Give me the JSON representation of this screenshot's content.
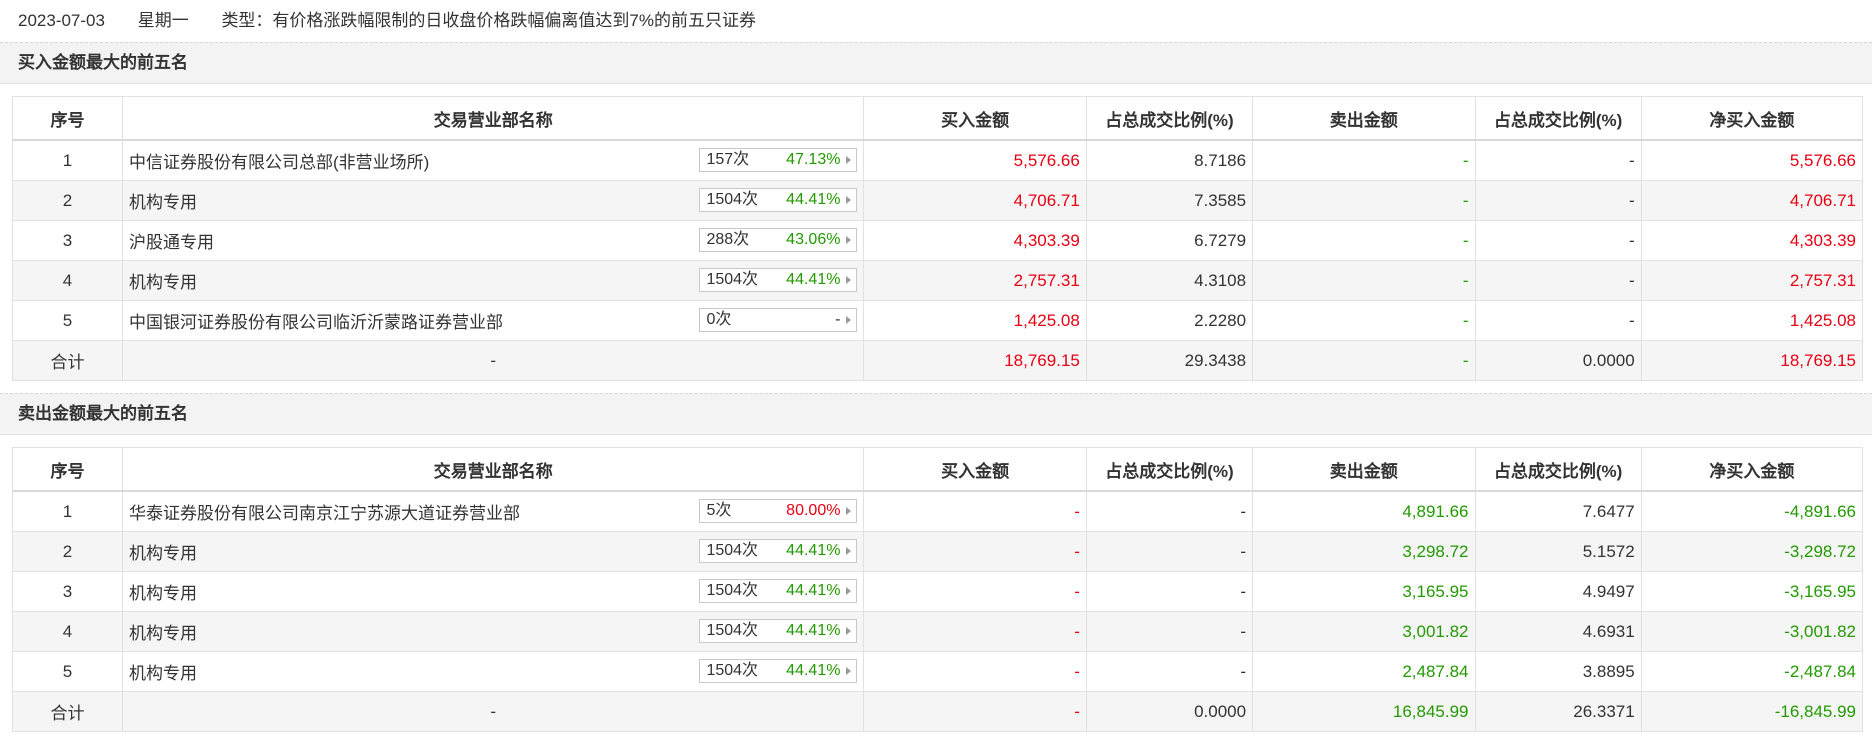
{
  "header": {
    "date": "2023-07-03",
    "weekday": "星期一",
    "type_text": "类型：有价格涨跌幅限制的日收盘价格跌幅偏离值达到7%的前五只证券"
  },
  "columns": [
    "序号",
    "交易营业部名称",
    "买入金额",
    "占总成交比例(%)",
    "卖出金额",
    "占总成交比例(%)",
    "净买入金额"
  ],
  "buy_section": {
    "title": "买入金额最大的前五名",
    "rows": [
      {
        "idx": "1",
        "name": "中信证券股份有限公司总部(非营业场所)",
        "count": "157次",
        "pct": "47.13%",
        "pct_color": "green",
        "buy": "5,576.66",
        "buy_ratio": "8.7186",
        "sell": "-",
        "sell_ratio": "-",
        "net": "5,576.66"
      },
      {
        "idx": "2",
        "name": "机构专用",
        "count": "1504次",
        "pct": "44.41%",
        "pct_color": "green",
        "buy": "4,706.71",
        "buy_ratio": "7.3585",
        "sell": "-",
        "sell_ratio": "-",
        "net": "4,706.71"
      },
      {
        "idx": "3",
        "name": "沪股通专用",
        "count": "288次",
        "pct": "43.06%",
        "pct_color": "green",
        "buy": "4,303.39",
        "buy_ratio": "6.7279",
        "sell": "-",
        "sell_ratio": "-",
        "net": "4,303.39"
      },
      {
        "idx": "4",
        "name": "机构专用",
        "count": "1504次",
        "pct": "44.41%",
        "pct_color": "green",
        "buy": "2,757.31",
        "buy_ratio": "4.3108",
        "sell": "-",
        "sell_ratio": "-",
        "net": "2,757.31"
      },
      {
        "idx": "5",
        "name": "中国银河证券股份有限公司临沂沂蒙路证券营业部",
        "count": "0次",
        "pct": "-",
        "pct_color": "dark",
        "buy": "1,425.08",
        "buy_ratio": "2.2280",
        "sell": "-",
        "sell_ratio": "-",
        "net": "1,425.08"
      }
    ],
    "total": {
      "label": "合计",
      "name": "-",
      "buy": "18,769.15",
      "buy_ratio": "29.3438",
      "sell": "-",
      "sell_ratio": "0.0000",
      "net": "18,769.15"
    }
  },
  "sell_section": {
    "title": "卖出金额最大的前五名",
    "rows": [
      {
        "idx": "1",
        "name": "华泰证券股份有限公司南京江宁苏源大道证券营业部",
        "count": "5次",
        "pct": "80.00%",
        "pct_color": "red",
        "buy": "-",
        "buy_ratio": "-",
        "sell": "4,891.66",
        "sell_ratio": "7.6477",
        "net": "-4,891.66"
      },
      {
        "idx": "2",
        "name": "机构专用",
        "count": "1504次",
        "pct": "44.41%",
        "pct_color": "green",
        "buy": "-",
        "buy_ratio": "-",
        "sell": "3,298.72",
        "sell_ratio": "5.1572",
        "net": "-3,298.72"
      },
      {
        "idx": "3",
        "name": "机构专用",
        "count": "1504次",
        "pct": "44.41%",
        "pct_color": "green",
        "buy": "-",
        "buy_ratio": "-",
        "sell": "3,165.95",
        "sell_ratio": "4.9497",
        "net": "-3,165.95"
      },
      {
        "idx": "4",
        "name": "机构专用",
        "count": "1504次",
        "pct": "44.41%",
        "pct_color": "green",
        "buy": "-",
        "buy_ratio": "-",
        "sell": "3,001.82",
        "sell_ratio": "4.6931",
        "net": "-3,001.82"
      },
      {
        "idx": "5",
        "name": "机构专用",
        "count": "1504次",
        "pct": "44.41%",
        "pct_color": "green",
        "buy": "-",
        "buy_ratio": "-",
        "sell": "2,487.84",
        "sell_ratio": "3.8895",
        "net": "-2,487.84"
      }
    ],
    "total": {
      "label": "合计",
      "name": "-",
      "buy": "-",
      "buy_ratio": "0.0000",
      "sell": "16,845.99",
      "sell_ratio": "26.3371",
      "net": "-16,845.99"
    }
  },
  "colors": {
    "up": "#e60012",
    "down": "#229a00",
    "alt_row": "#f5f5f5",
    "section_bg": "#f3f3f3"
  }
}
